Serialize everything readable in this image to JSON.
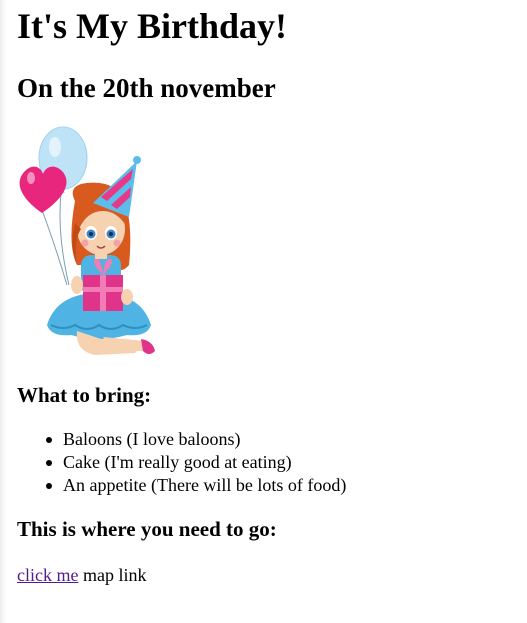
{
  "page": {
    "title": "It's My Birthday!",
    "subtitle": "On the 20th november",
    "illustration": "cartoon girl in party hat holding balloons and a gift"
  },
  "bring": {
    "heading": "What to bring:",
    "items": [
      {
        "label": "Baloons (I love baloons)"
      },
      {
        "label": "Cake (I'm really good at eating)"
      },
      {
        "label": "An appetite (There will be lots of food)"
      }
    ]
  },
  "location": {
    "heading": "This is where you need to go:",
    "link_text": "click me",
    "after_link_text": " map link"
  },
  "colors": {
    "visited_link": "#551a8b",
    "hat_pink": "#e8388a",
    "hat_blue": "#5bbde8",
    "dress_blue": "#4fb3e3",
    "gift_pink": "#e0338a",
    "hair": "#d95a1f"
  }
}
